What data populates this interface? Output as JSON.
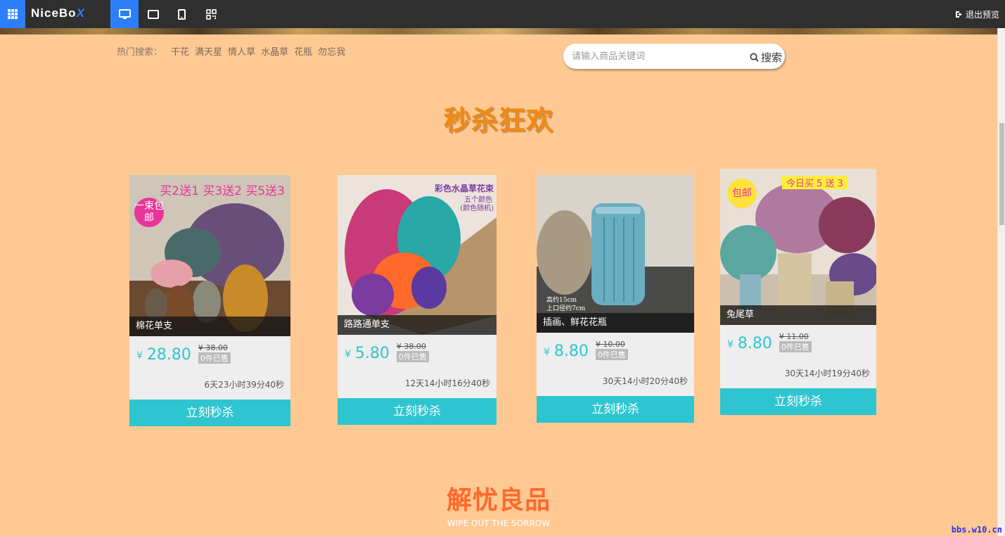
{
  "toolbar": {
    "logo_main": "NiceBo",
    "logo_x": "X",
    "exit_label": "退出预览"
  },
  "search": {
    "hot_label": "热门搜索：",
    "hot_keywords": [
      "干花",
      "满天星",
      "情人草",
      "水晶草",
      "花瓶",
      "勿忘我"
    ],
    "placeholder": "请输入商品关键词",
    "button_label": "搜索"
  },
  "section_flash": {
    "title": "秒杀狂欢"
  },
  "products": [
    {
      "name": "棉花单支",
      "currency": "¥",
      "price": "28.80",
      "old_price": "¥ 38.00",
      "sold": "0件已售",
      "countdown": "6天23小时39分40秒",
      "buy_label": "立刻秒杀",
      "promo": "买2送1 买3送2 买5送3",
      "badge": "一束包邮"
    },
    {
      "name": "路路通单支",
      "currency": "¥",
      "price": "5.80",
      "old_price": "¥ 38.00",
      "sold": "0件已售",
      "countdown": "12天14小时16分40秒",
      "buy_label": "立刻秒杀",
      "promo": "彩色水晶草花束",
      "promo_sub1": "五个颜色",
      "promo_sub2": "(颜色随机)"
    },
    {
      "name": "插画、鲜花花瓶",
      "currency": "¥",
      "price": "8.80",
      "old_price": "¥ 10.00",
      "sold": "0件已售",
      "countdown": "30天14小时20分40秒",
      "buy_label": "立刻秒杀",
      "spec1": "高约15cm",
      "spec2": "上口径约7cm"
    },
    {
      "name": "兔尾草",
      "currency": "¥",
      "price": "8.80",
      "old_price": "¥ 11.00",
      "sold": "0件已售",
      "countdown": "30天14小时19分40秒",
      "buy_label": "立刻秒杀",
      "promo": "今日买 5 送 3",
      "badge": "包邮"
    }
  ],
  "section_goods": {
    "title": "解忧良品",
    "subtitle": "WIPE OUT THE SORROW"
  },
  "watermark": "bbs.w10.cn"
}
